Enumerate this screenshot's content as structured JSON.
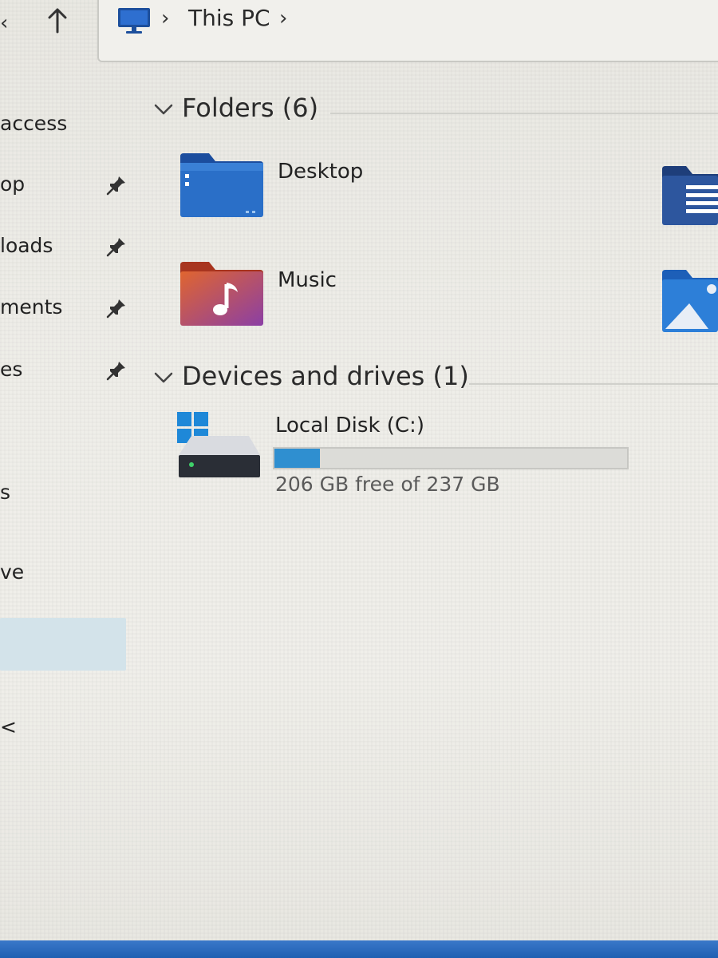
{
  "breadcrumb": {
    "separator": "›",
    "current": "This PC"
  },
  "sidebar": {
    "items": [
      {
        "label": "access",
        "pinned": false
      },
      {
        "label": "op",
        "pinned": true
      },
      {
        "label": "loads",
        "pinned": true
      },
      {
        "label": "ments",
        "pinned": true
      },
      {
        "label": "es",
        "pinned": true
      },
      {
        "label": "s",
        "pinned": false
      },
      {
        "label": "ve",
        "pinned": false
      },
      {
        "label": "<",
        "pinned": false
      }
    ]
  },
  "main": {
    "folders_header": "Folders (6)",
    "folders": [
      {
        "label": "Desktop",
        "icon": "desktop-folder-icon"
      },
      {
        "label": "Music",
        "icon": "music-folder-icon"
      },
      {
        "label": "",
        "icon": "documents-folder-icon"
      },
      {
        "label": "",
        "icon": "pictures-folder-icon"
      }
    ],
    "drives_header": "Devices and drives (1)",
    "drives": [
      {
        "label": "Local Disk (C:)",
        "free_text": "206 GB free of 237 GB",
        "used_fraction": 0.13
      }
    ]
  },
  "colors": {
    "accent": "#2f8fd0",
    "folder_blue": "#2a6fc8",
    "folder_music": "#d3553a",
    "selection": "#d3e3ea"
  }
}
